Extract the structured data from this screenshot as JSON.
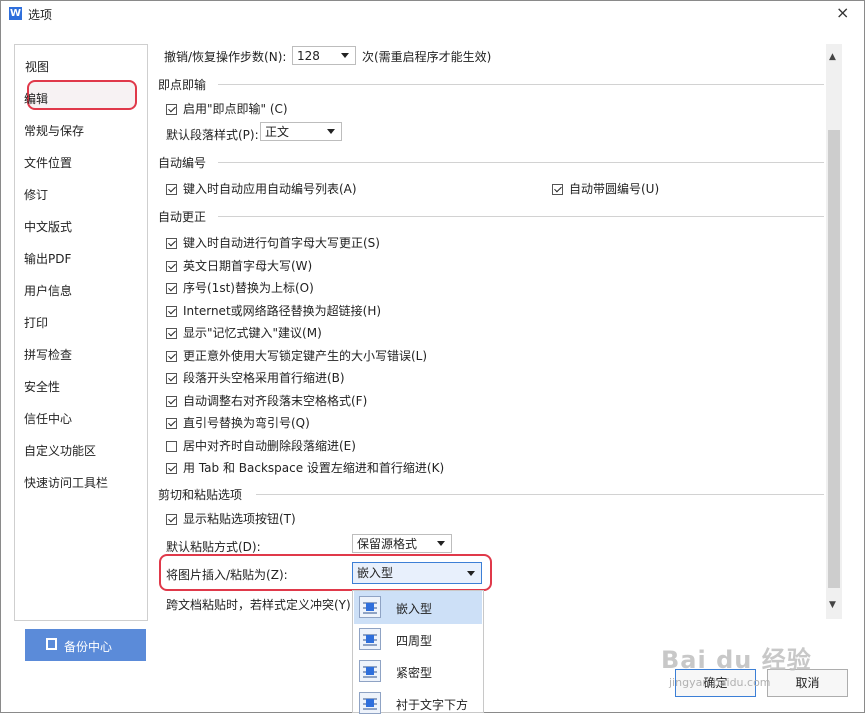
{
  "window": {
    "title": "选项",
    "app_icon": "W",
    "close_glyph": "×"
  },
  "sidebar": {
    "items": [
      {
        "label": "视图"
      },
      {
        "label": "编辑"
      },
      {
        "label": "常规与保存"
      },
      {
        "label": "文件位置"
      },
      {
        "label": "修订"
      },
      {
        "label": "中文版式"
      },
      {
        "label": "输出PDF"
      },
      {
        "label": "用户信息"
      },
      {
        "label": "打印"
      },
      {
        "label": "拼写检查"
      },
      {
        "label": "安全性"
      },
      {
        "label": "信任中心"
      },
      {
        "label": "自定义功能区"
      },
      {
        "label": "快速访问工具栏"
      }
    ],
    "selected": "编辑"
  },
  "backup": {
    "label": "备份中心"
  },
  "content": {
    "undo": {
      "label": "撤销/恢复操作步数(N):",
      "value": "128",
      "suffix": "次(需重启程序才能生效)"
    },
    "click_input": {
      "section": "即点即输",
      "enable": "启用\"即点即输\" (C)",
      "para_style_label": "默认段落样式(P):",
      "para_style_value": "正文"
    },
    "auto_number": {
      "section": "自动编号",
      "left": "键入时自动应用自动编号列表(A)",
      "right": "自动带圆编号(U)"
    },
    "autocorrect": {
      "section": "自动更正",
      "items": [
        {
          "label": "键入时自动进行句首字母大写更正(S)",
          "checked": true
        },
        {
          "label": "英文日期首字母大写(W)",
          "checked": true
        },
        {
          "label": "序号(1st)替换为上标(O)",
          "checked": true
        },
        {
          "label": "Internet或网络路径替换为超链接(H)",
          "checked": true
        },
        {
          "label": "显示\"记忆式键入\"建议(M)",
          "checked": true
        },
        {
          "label": "更正意外使用大写锁定键产生的大小写错误(L)",
          "checked": true
        },
        {
          "label": "段落开头空格采用首行缩进(B)",
          "checked": true
        },
        {
          "label": "自动调整右对齐段落末空格格式(F)",
          "checked": true
        },
        {
          "label": "直引号替换为弯引号(Q)",
          "checked": true
        },
        {
          "label": "居中对齐时自动删除段落缩进(E)",
          "checked": false
        },
        {
          "label": "用 Tab 和 Backspace 设置左缩进和首行缩进(K)",
          "checked": true
        }
      ]
    },
    "paste": {
      "section": "剪切和粘贴选项",
      "show_button": "显示粘贴选项按钮(T)",
      "default_label": "默认粘贴方式(D):",
      "default_value": "保留源格式",
      "image_label": "将图片插入/粘贴为(Z):",
      "image_value": "嵌入型",
      "conflict_label": "跨文档粘贴时，若样式定义冲突(Y):"
    }
  },
  "popup": {
    "options": [
      "嵌入型",
      "四周型",
      "紧密型",
      "衬于文字下方"
    ],
    "selected": "嵌入型"
  },
  "footer": {
    "ok": "确定",
    "cancel": "取消"
  },
  "watermark": {
    "line1": "Bai du 经验",
    "line2": "jingyan.baidu.com"
  },
  "colors": {
    "accent": "#3c7fd6",
    "highlight": "#e0394a",
    "backup_bg": "#5b8bd9"
  }
}
